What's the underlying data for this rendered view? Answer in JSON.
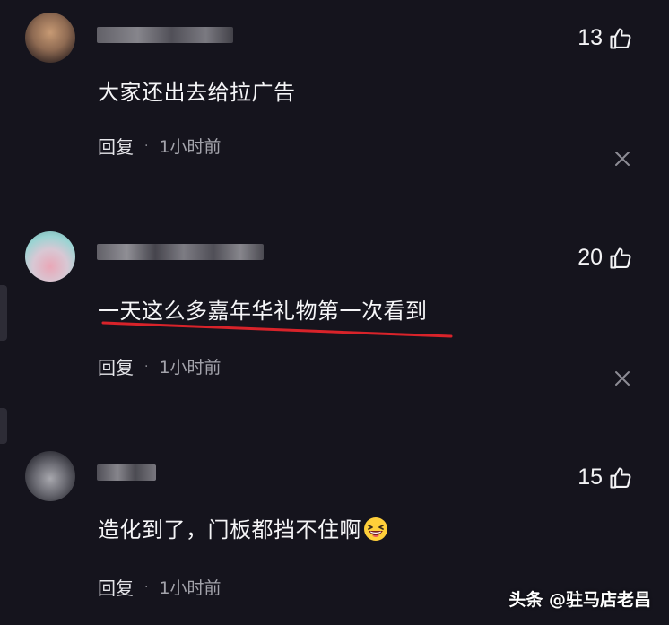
{
  "comments": [
    {
      "likes": "13",
      "text": "大家还出去给拉广告",
      "reply_label": "回复",
      "separator": "·",
      "time": "1小时前"
    },
    {
      "likes": "20",
      "text": "一天这么多嘉年华礼物第一次看到",
      "reply_label": "回复",
      "separator": "·",
      "time": "1小时前"
    },
    {
      "likes": "15",
      "text": "造化到了，门板都挡不住啊",
      "reply_label": "回复",
      "separator": "·",
      "time": "1小时前",
      "emoji": "grinning-squinting-face"
    }
  ],
  "watermark": "头条 @驻马店老昌",
  "colors": {
    "background": "#15141d",
    "highlight_underline": "#d8232a",
    "emoji_face": "#ffcf3a"
  }
}
